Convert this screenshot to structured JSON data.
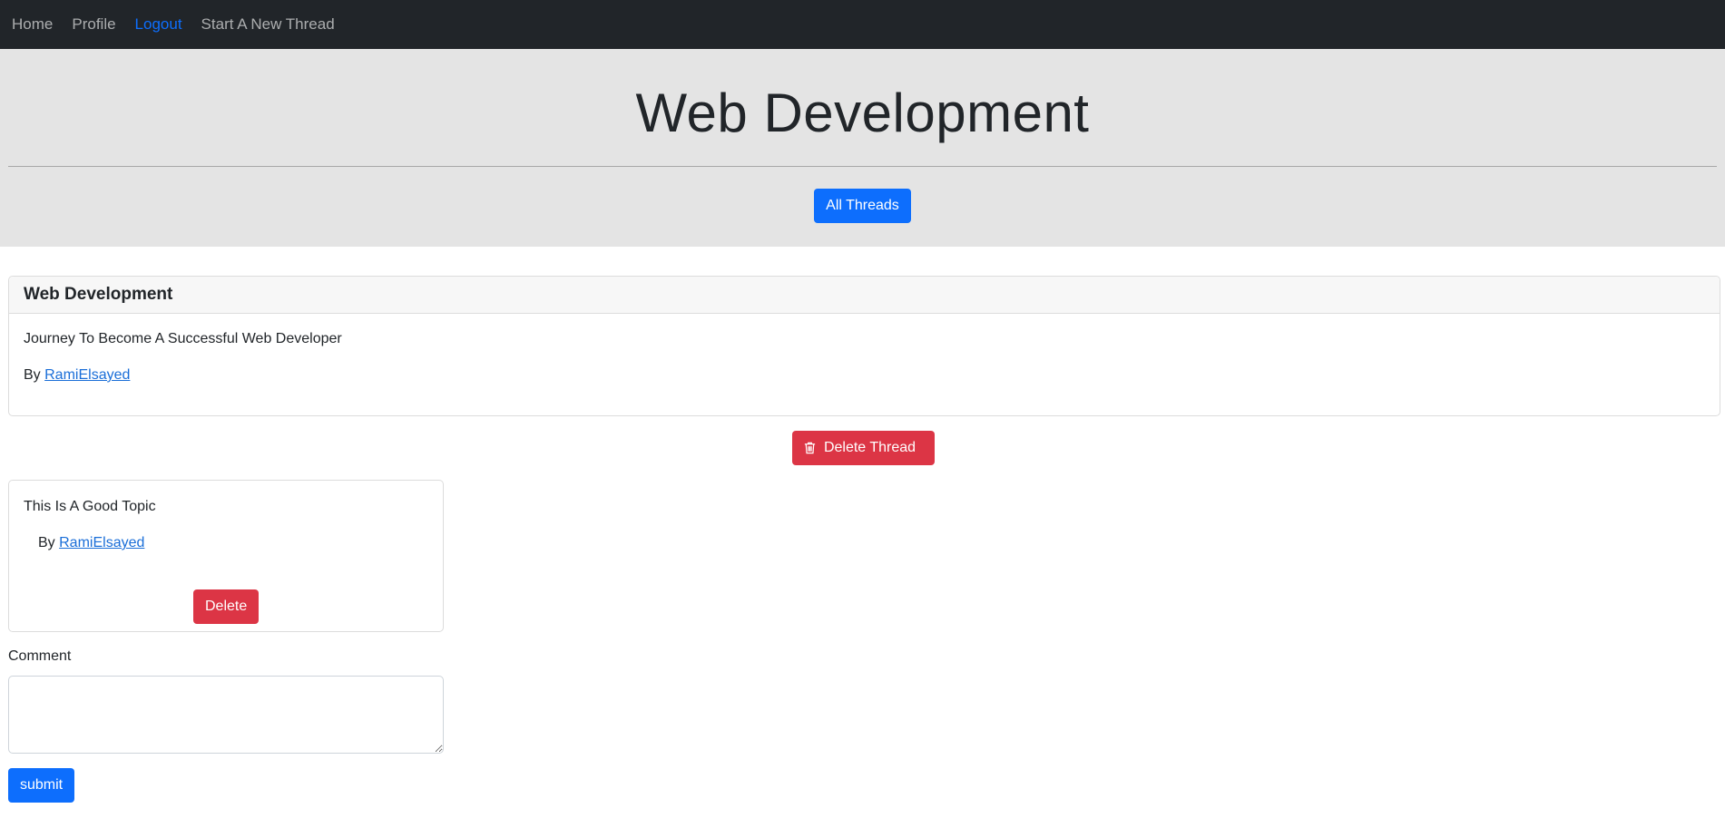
{
  "navbar": {
    "links": [
      {
        "label": "Home"
      },
      {
        "label": "Profile"
      },
      {
        "label": "Logout"
      },
      {
        "label": "Start A New Thread"
      }
    ]
  },
  "hero": {
    "title": "Web Development",
    "all_threads_label": "All Threads"
  },
  "thread": {
    "category": "Web Development",
    "title": "Journey To Become A Successful Web Developer",
    "by_prefix": "By",
    "author": "RamiElsayed",
    "delete_label": "Delete Thread",
    "delete_icon": "trash-icon"
  },
  "comments": [
    {
      "text": "This Is A Good Topic",
      "by_prefix": "By",
      "author": "RamiElsayed",
      "delete_label": "Delete"
    }
  ],
  "comment_form": {
    "label": "Comment",
    "value": "",
    "submit_label": "submit"
  },
  "colors": {
    "navbar_bg": "#212529",
    "hero_bg": "#e4e4e4",
    "primary": "#0d6efd",
    "danger": "#dc3545",
    "link": "#1a6ed8"
  }
}
